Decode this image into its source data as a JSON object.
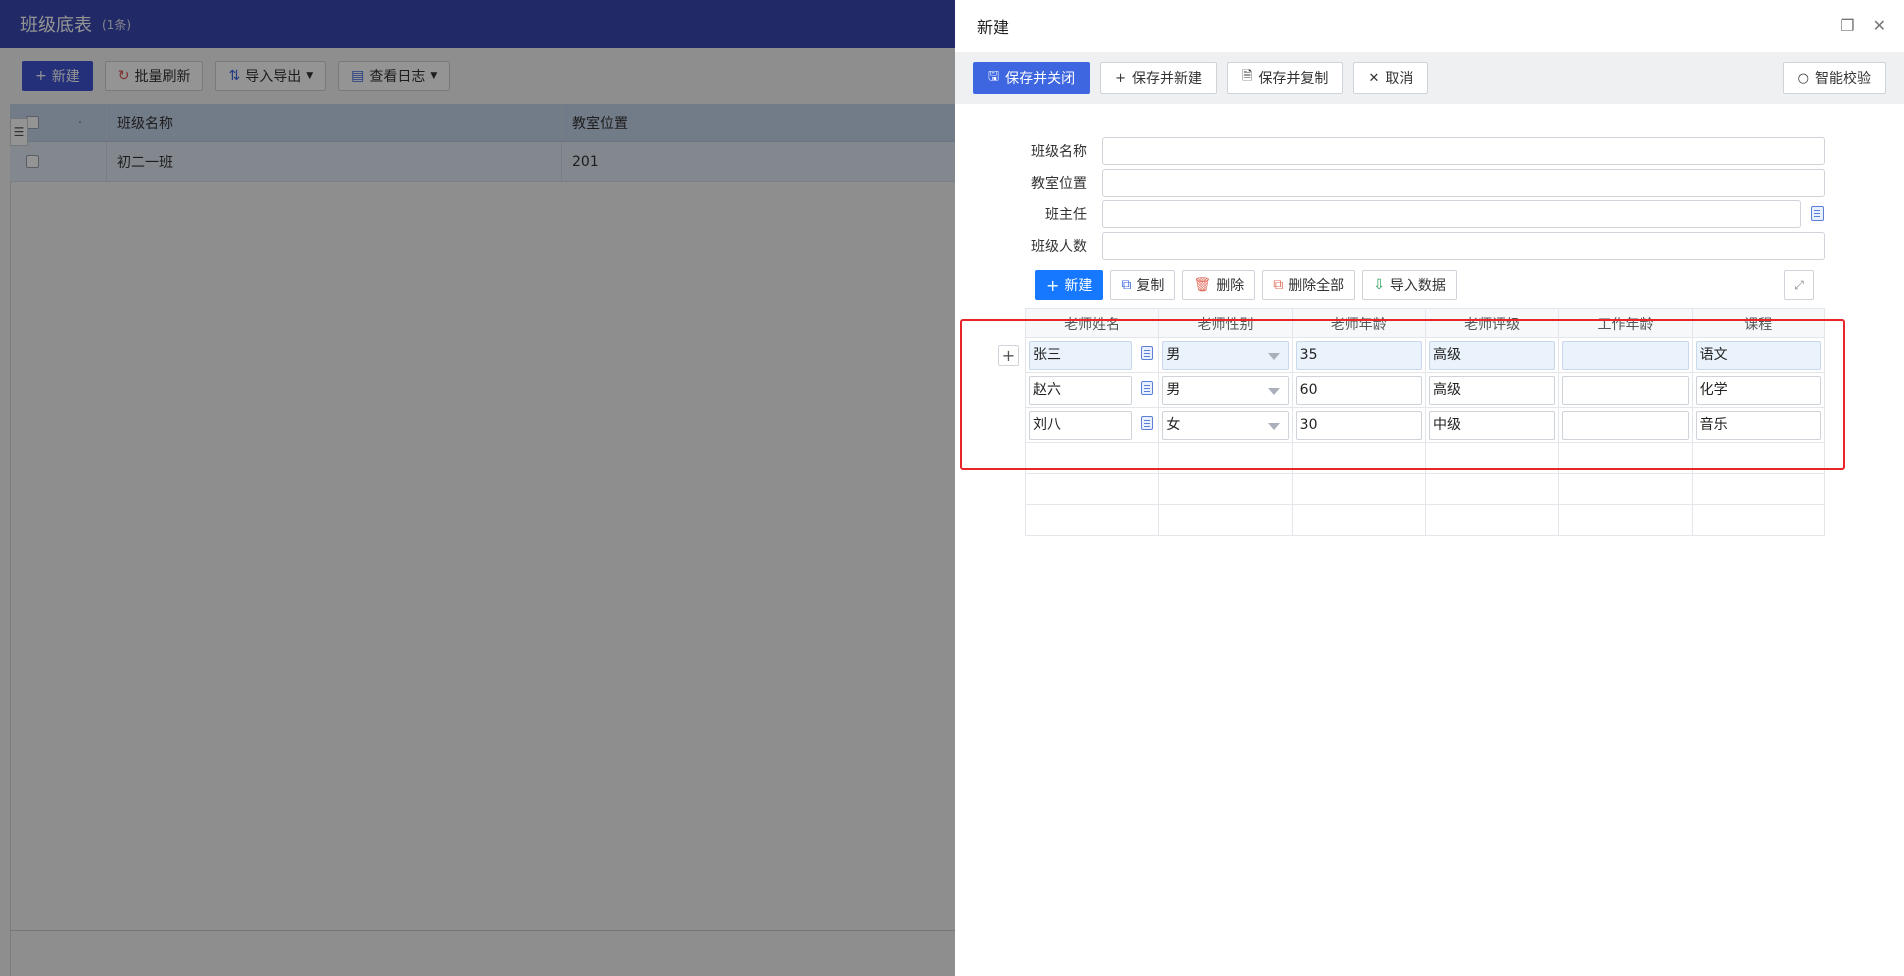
{
  "background": {
    "title": "班级底表",
    "count": "(1条)",
    "toolbar": {
      "new_label": "新建",
      "refresh_label": "批量刷新",
      "import_export_label": "导入导出",
      "view_log_label": "查看日志"
    },
    "grid": {
      "columns": [
        "班级名称",
        "教室位置"
      ],
      "rows": [
        {
          "name": "初二一班",
          "room": "201"
        }
      ]
    }
  },
  "drawer": {
    "title": "新建",
    "toolbar": {
      "save_close": "保存并关闭",
      "save_new": "保存并新建",
      "save_copy": "保存并复制",
      "cancel": "取消",
      "smart_check": "智能校验"
    },
    "form": {
      "class_name_label": "班级名称",
      "classroom_label": "教室位置",
      "head_teacher_label": "班主任",
      "class_size_label": "班级人数"
    },
    "subtoolbar": {
      "new": "新建",
      "copy": "复制",
      "delete": "删除",
      "delete_all": "删除全部",
      "import": "导入数据"
    },
    "subgrid": {
      "columns": [
        "老师姓名",
        "老师性别",
        "老师年龄",
        "老师评级",
        "工作年龄",
        "课程"
      ],
      "rows": [
        {
          "name": "张三",
          "gender": "男",
          "age": "35",
          "grade": "高级",
          "work_age": "",
          "course": "语文"
        },
        {
          "name": "赵六",
          "gender": "男",
          "age": "60",
          "grade": "高级",
          "work_age": "",
          "course": "化学"
        },
        {
          "name": "刘八",
          "gender": "女",
          "age": "30",
          "grade": "中级",
          "work_age": "",
          "course": "音乐"
        }
      ]
    }
  },
  "colors": {
    "header_bg": "#3949b0",
    "primary": "#3e66e0",
    "highlight_border": "#e8262a"
  }
}
